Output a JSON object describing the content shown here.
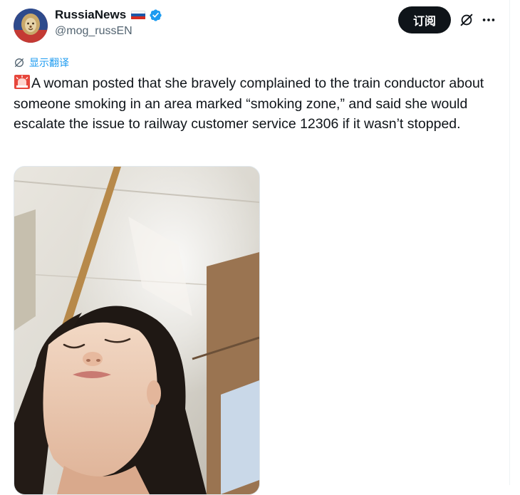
{
  "author": {
    "display_name": "RussiaNews",
    "handle": "@mog_russEN",
    "avatar_icon": "lion-avatar",
    "flag_icon": "russia-flag-icon",
    "verified_icon": "verified-badge-icon"
  },
  "header": {
    "subscribe_label": "订阅",
    "grok_icon": "grok-icon",
    "more_icon": "more-icon"
  },
  "translate": {
    "label": "显示翻译",
    "icon": "translate-globe-icon"
  },
  "tweet": {
    "emoji": "siren-emoji",
    "text": "A woman posted that she bravely complained to the train conductor about someone smoking in an area marked “smoking zone,” and said she would escalate the issue to railway customer service 12306 if it wasn’t stopped."
  },
  "media": {
    "alt": "Selfie of a woman on a train, eyes closed, looking up",
    "type": "photo"
  },
  "colors": {
    "accent": "#1d9bf0",
    "text": "#0f1419",
    "muted": "#536471",
    "button": "#0f1419"
  }
}
